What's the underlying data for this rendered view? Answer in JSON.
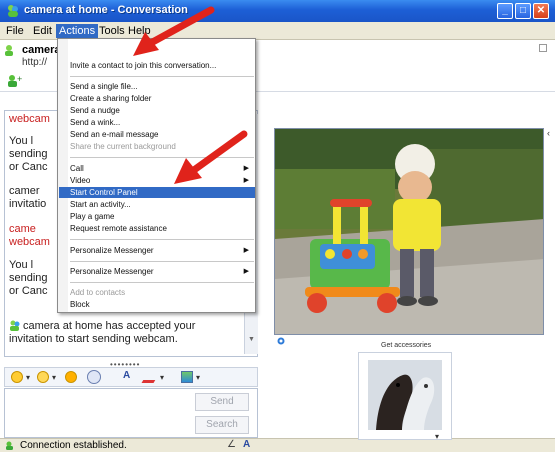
{
  "window": {
    "title": "camera at home - Conversation"
  },
  "menubar": {
    "items": [
      "File",
      "Edit",
      "Actions",
      "Tools",
      "Help"
    ],
    "active": "Actions"
  },
  "header": {
    "contact_name": "camera at home",
    "contact_sub": "http://"
  },
  "actions_menu": {
    "items": [
      {
        "label": "Invite a contact to join this conversation..."
      },
      {
        "label": "Send a single file..."
      },
      {
        "label": "Create a sharing folder"
      },
      {
        "label": "Send a nudge"
      },
      {
        "label": "Send a wink..."
      },
      {
        "label": "Send an e-mail message"
      },
      {
        "label": "Share the current background",
        "disabled": true
      },
      {
        "label": "Call",
        "submenu": true
      },
      {
        "label": "Video",
        "submenu": true
      },
      {
        "label": "Start Control Panel",
        "highlighted": true
      },
      {
        "label": "Start an activity..."
      },
      {
        "label": "Play a game"
      },
      {
        "label": "Request remote assistance"
      },
      {
        "label": "Personalize Messenger",
        "submenu": true
      },
      {
        "label": "Personalize Messenger",
        "submenu": true
      },
      {
        "label": "Add to contacts",
        "disabled": true
      },
      {
        "label": "Block"
      }
    ]
  },
  "conversation": {
    "lines": [
      "camera at home has accepted your",
      "invitation to start sending webcam."
    ],
    "partial": [
      "webcam",
      "You l",
      "sending",
      "or Canc",
      "camer",
      "invitatio",
      "came",
      "webcam",
      "You l",
      "sending",
      "or Canc"
    ]
  },
  "input": {
    "send_label": "Send",
    "search_label": "Search"
  },
  "status": {
    "text": "Connection established."
  },
  "accessories": {
    "label": "Get accessories"
  },
  "colors": {
    "menu_highlight": "#316ac5",
    "title_bar": "#1d5fd6",
    "arrow": "#e0231b"
  }
}
